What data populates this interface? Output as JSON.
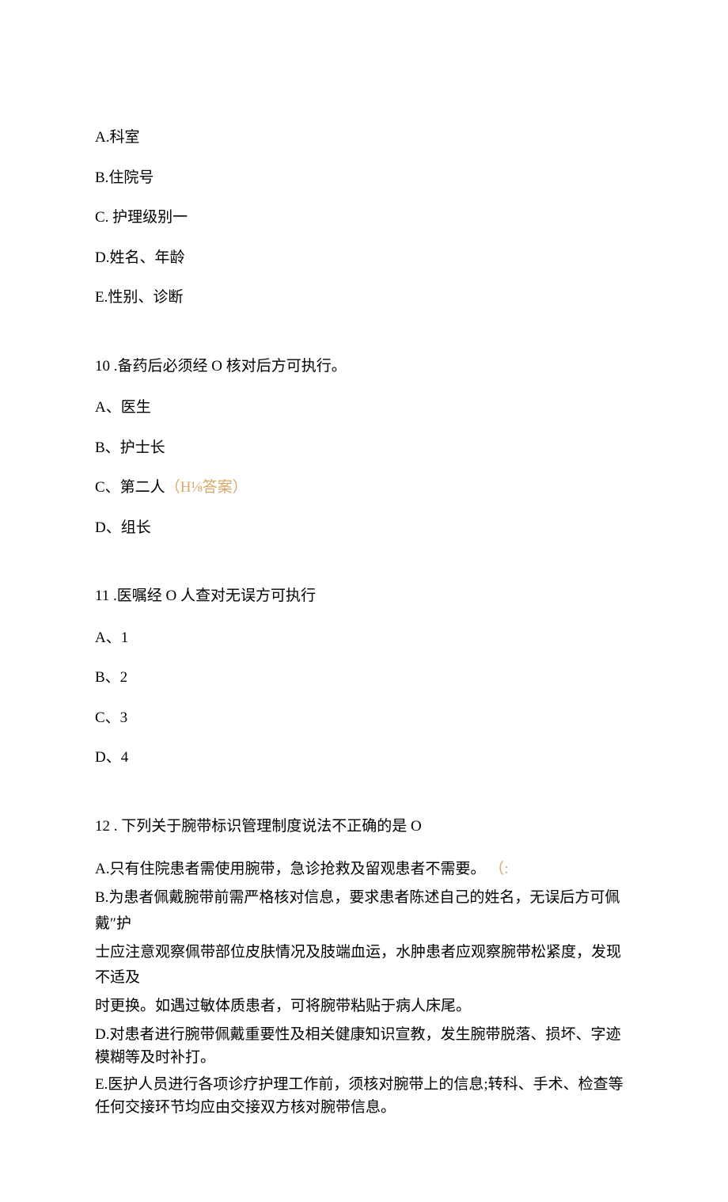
{
  "q9": {
    "options": {
      "a": "A.科室",
      "b": "B.住院号",
      "c": "C. 护理级别一",
      "d": "D.姓名、年龄",
      "e": "E.性别、诊断"
    }
  },
  "q10": {
    "stem": "10 .备药后必须经 O 核对后方可执行。",
    "options": {
      "a": "A、医生",
      "b": "B、护士长",
      "c_prefix": "C、第二人",
      "c_answer": "（H⅛答案）",
      "d": "D、组长"
    }
  },
  "q11": {
    "stem": "11 .医嘱经 O 人查对无误方可执行",
    "options": {
      "a": "A、1",
      "b": "B、2",
      "c": "C、3",
      "d": "D、4"
    }
  },
  "q12": {
    "stem": "12 . 下列关于腕带标识管理制度说法不正确的是 O",
    "a_text": "A.只有住院患者需使用腕带，急诊抢救及留观患者不需要。",
    "a_mark": "（:",
    "b_line1": "B.为患者佩戴腕带前需严格核对信息，要求患者陈述自己的姓名，无误后方可佩戴″护",
    "b_line2": "士应注意观察佩带部位皮肤情况及肢端血运，水肿患者应观察腕带松紧度，发现不适及",
    "b_line3": "时更换。如遇过敏体质患者，可将腕带粘贴于病人床尾。",
    "d_line1": "D.对患者进行腕带佩戴重要性及相关健康知识宣教，发生腕带脱落、损坏、字迹模糊等及时补打。",
    "e_line1": "E.医护人员进行各项诊疗护理工作前，须核对腕带上的信息;转科、手术、检查等任何交接环节均应由交接双方核对腕带信息。"
  }
}
